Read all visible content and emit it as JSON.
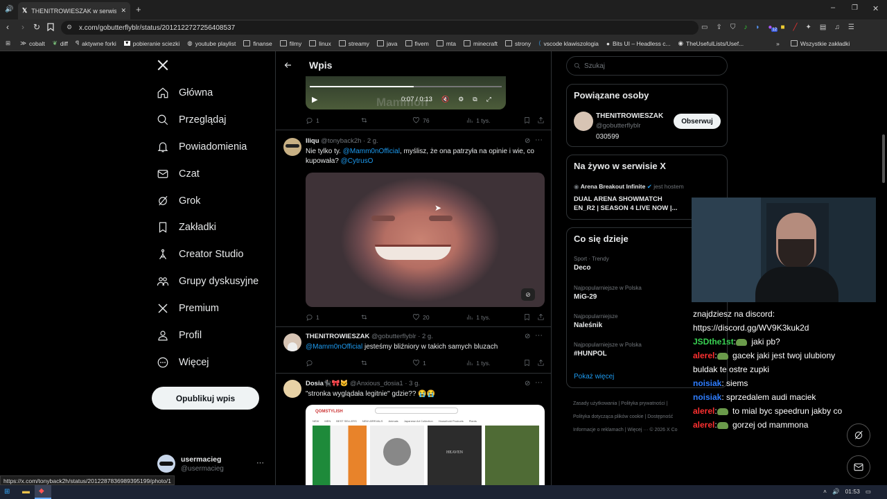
{
  "browser": {
    "tab_title": "THENITROWIESZAK w serwisie X",
    "url": "x.com/gobutterflyblr/status/2012122727256408537",
    "status_url": "https://x.com/tonyback2h/status/2012287836989395199/photo/1",
    "bookmarks": [
      "cobalt",
      "diff",
      "aktywne forki",
      "pobieranie sciezki",
      "youtube playlist",
      "finanse",
      "filmy",
      "linux",
      "streamy",
      "java",
      "fivem",
      "mta",
      "minecraft",
      "strony",
      "vscode klawiszologia",
      "Bits UI – Headless c...",
      "TheUsefulLists/Usef..."
    ],
    "bookmarks_all": "Wszystkie zakładki",
    "ext_badge": "12",
    "clock": "01:53"
  },
  "sidebar": {
    "items": [
      "Główna",
      "Przeglądaj",
      "Powiadomienia",
      "Czat",
      "Grok",
      "Zakładki",
      "Creator Studio",
      "Grupy dyskusyjne",
      "Premium",
      "Profil",
      "Więcej"
    ],
    "post_button": "Opublikuj wpis",
    "user_name": "usermacieg",
    "user_handle": "@usermacieg",
    "more": "···"
  },
  "feed": {
    "title": "Wpis",
    "video_time": "0:07 / 0:13",
    "video_watermark": "Mammon",
    "first_stats": {
      "replies": "1",
      "likes": "76",
      "views": "1 tys."
    },
    "tweets": [
      {
        "name": "lliqu",
        "handle": "@tonyback2h",
        "time": "· 2 g.",
        "pre": "Nie tylko ty. ",
        "mention1": "@Mamm0nOfficial",
        "mid": ", myślisz, że ona patrzyła na opinie i wie, co kupowała? ",
        "mention2": "@CytrusO",
        "replies": "1",
        "likes": "20",
        "views": "1 tys."
      },
      {
        "name": "THENITROWIESZAK",
        "handle": "@gobutterflyblr",
        "time": "· 2 g.",
        "mention1": "@Mamm0nOfficial",
        "text": " jesteśmy bliźniory w takich samych bluzach",
        "likes": "1",
        "views": "1 tys."
      },
      {
        "name": "Dosia🐈‍⬛🎀🐱",
        "handle": "@Anxious_dosia1",
        "time": "· 3 g.",
        "text": "\"stronka wyglądała legitnie\" gdzie?? 😭😭"
      }
    ],
    "shop": {
      "brand": "QOMSTYLISH",
      "menu": [
        "NEW",
        "MEN",
        "BEST SELLERS",
        "NEW ARRIVALS",
        "Animals",
        "Japanese Art Collection",
        "Household Products",
        "Plants"
      ],
      "heaven": "HEAVEN"
    }
  },
  "right": {
    "search_placeholder": "Szukaj",
    "related_title": "Powiązane osoby",
    "related_name": "THENITROWIESZAK",
    "related_handle": "@gobutterflyblr",
    "related_bio": "030599",
    "follow": "Obserwuj",
    "live_title": "Na żywo w serwisie X",
    "live_host": "Arena Breakout Infinite",
    "live_host_suffix": "jest hostem",
    "live_text": "DUAL ARENA SHOWMATCH EN_R2 | SEASON 4 LIVE NOW |...",
    "trending_title": "Co się dzieje",
    "trends": [
      {
        "meta": "Sport · Trendy",
        "name": "Deco"
      },
      {
        "meta": "Najpopularniejsze w Polska",
        "name": "MiG-29"
      },
      {
        "meta": "Najpopularniejsze",
        "name": "Naleśnik"
      },
      {
        "meta": "Najpopularniejsze w Polska",
        "name": "#HUNPOL"
      }
    ],
    "show_more": "Pokaż więcej",
    "footer1": "Zasady użytkowania  |  Polityka prywatności  |",
    "footer2": "Polityka dotycząca plików cookie  |  Dostępność",
    "footer3": "Informacje o reklamach  |  Więcej ···  © 2026 X Co"
  },
  "chat": {
    "lines": [
      {
        "user": "",
        "text": "znajdziesz na discord:"
      },
      {
        "user": "",
        "text": "https://discord.gg/WV9K3kuk2d"
      },
      {
        "user": "JSDthe1st",
        "color": "#39d353",
        "text": " jaki pb?",
        "emote": true
      },
      {
        "user": "alerel",
        "color": "#ff3030",
        "text": " gacek jaki jest twoj ulubiony",
        "emote": true
      },
      {
        "user": "",
        "text": "buldak te ostre zupki"
      },
      {
        "user": "noisiak",
        "color": "#2e7dff",
        "text": ": siems"
      },
      {
        "user": "noisiak",
        "color": "#2e7dff",
        "text": ": sprzedalem audi maciek"
      },
      {
        "user": "alerel",
        "color": "#ff3030",
        "text": " to mial byc speedrun jakby co",
        "emote": true
      },
      {
        "user": "alerel",
        "color": "#ff3030",
        "text": " gorzej od mammona",
        "emote": true
      }
    ]
  }
}
